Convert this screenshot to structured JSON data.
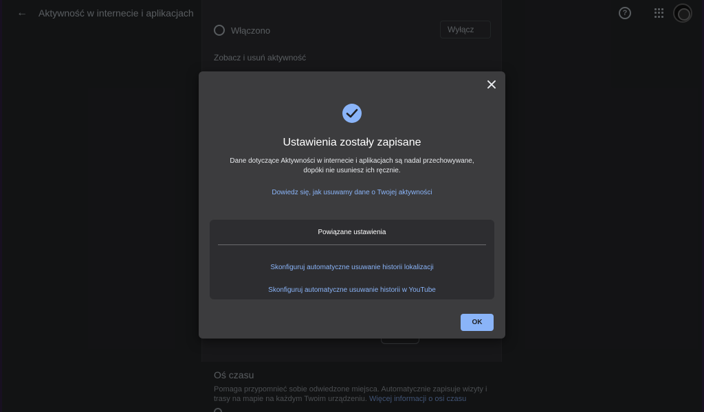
{
  "header": {
    "title": "Aktywność w internecie i aplikacjach"
  },
  "background": {
    "status_label": "Włączono",
    "disable_button": "Wyłącz",
    "activity_link": "Zobacz i usuń aktywność",
    "timeline": {
      "title": "Oś czasu",
      "description": "Pomaga przypomnieć sobie odwiedzone miejsca. Automatycznie zapisuje wizyty i trasy na mapie na każdym Twoim urządzeniu.",
      "more_link": "Więcej informacji o osi czasu"
    }
  },
  "dialog": {
    "title": "Ustawienia zostały zapisane",
    "description": "Dane dotyczące Aktywności w internecie i aplikacjach są nadal przechowywane, dopóki nie usuniesz ich ręcznie.",
    "learn_link": "Dowiedz się, jak usuwamy dane o Twojej aktywności",
    "related": {
      "title": "Powiązane ustawienia",
      "location_link": "Skonfiguruj automatyczne usuwanie historii lokalizacji",
      "youtube_link": "Skonfiguruj automatyczne usuwanie historii w YouTube"
    },
    "ok_label": "OK",
    "close_icon": "close-icon",
    "success_icon": "check-circle-icon"
  },
  "colors": {
    "accent": "#8ab4f8",
    "dialog_bg": "#3c3c3e",
    "page_bg": "#202124"
  }
}
